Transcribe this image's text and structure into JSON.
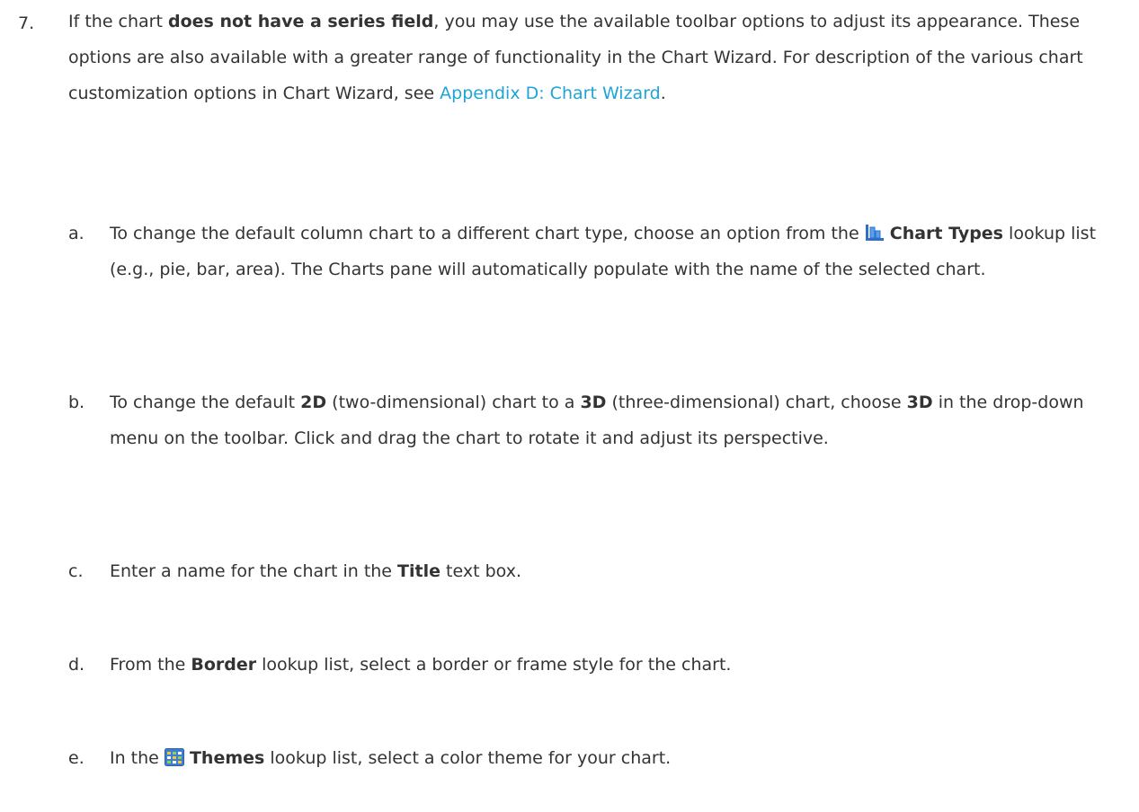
{
  "step": {
    "number": "7.",
    "text_1": "If the chart ",
    "bold_1": "does not have a series field",
    "text_2": ", you may use the available toolbar options to adjust its appearance. These options are also available with a greater range of functionality in the Chart Wizard. For description of the various chart customization options in Chart Wizard, see ",
    "link": "Appendix D: Chart Wizard",
    "text_3": "."
  },
  "substeps": [
    {
      "label": "a.",
      "t1": "To change the default column chart to a different chart type, choose an option from the ",
      "icon": "chart-types-icon",
      "b1": "Chart Types",
      "t2": " lookup list (e.g., pie, bar, area). The Charts pane will automatically populate with the name of the selected chart."
    },
    {
      "label": "b.",
      "t1": "To change the default ",
      "b1": "2D",
      "t2": " (two-dimensional) chart to a ",
      "b2": "3D",
      "t3": " (three-dimensional) chart, choose ",
      "b3": "3D",
      "t4": " in the drop-down menu on the toolbar. Click and drag the chart to rotate it and adjust its perspective."
    },
    {
      "label": "c.",
      "t1": "Enter a name for the chart in the ",
      "b1": "Title",
      "t2": " text box."
    },
    {
      "label": "d.",
      "t1": "From the ",
      "b1": "Border",
      "t2": " lookup list, select a border or frame style for the chart."
    },
    {
      "label": "e.",
      "t1": "In the ",
      "icon": "themes-icon",
      "b1": "Themes",
      "t2": " lookup list, select a color theme for your chart."
    }
  ],
  "colors": {
    "text": "#333333",
    "link": "#1fa4d6",
    "icon_blue": "#2f6fc9"
  }
}
